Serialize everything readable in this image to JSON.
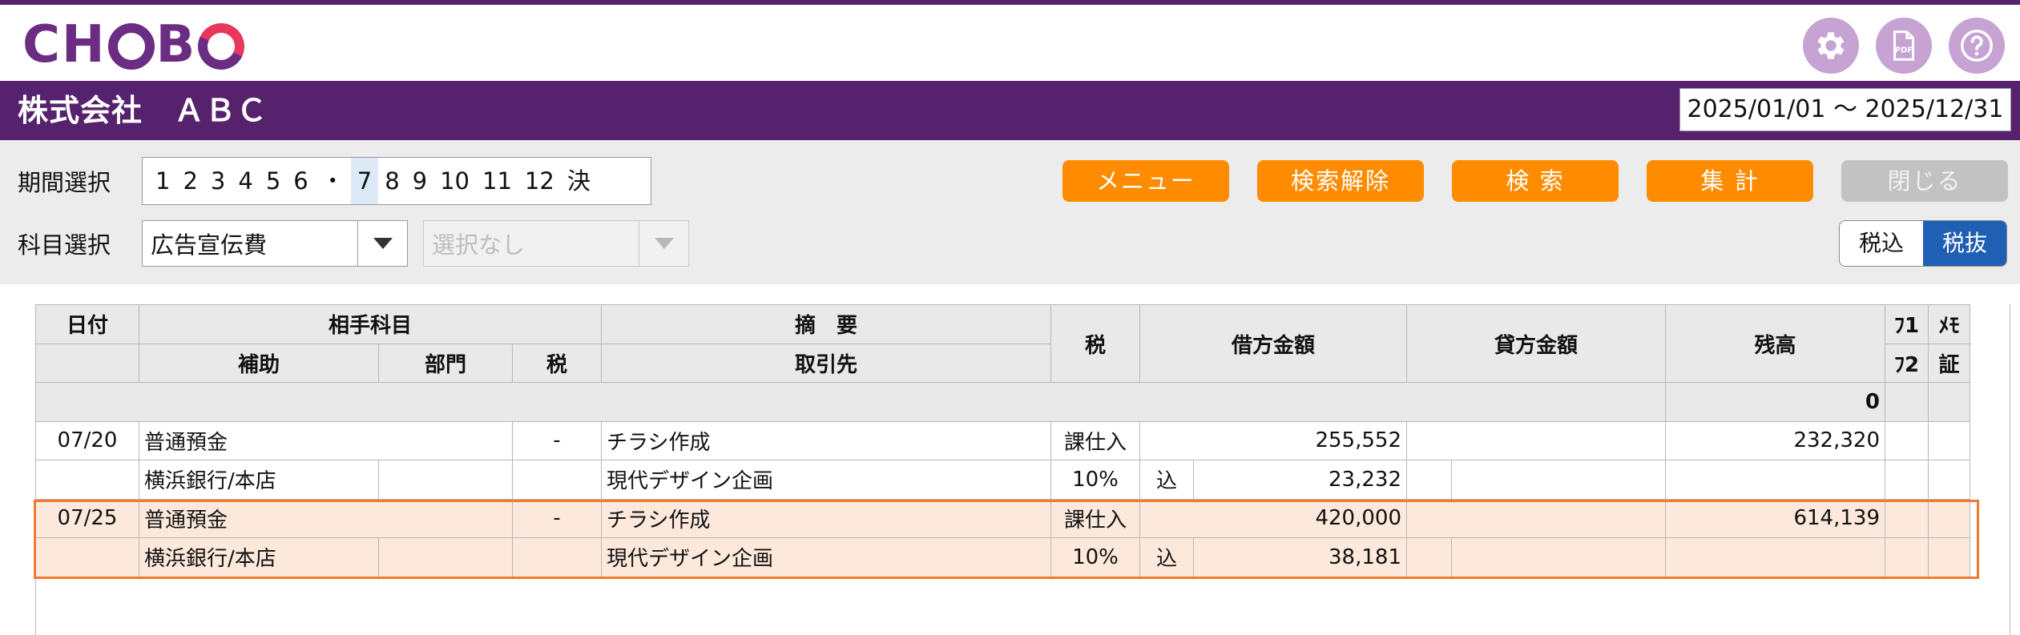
{
  "app": {
    "logo_text": "CHOBO",
    "logo_prefix": "CH",
    "logo_mid": "B",
    "brand_color": "#56226d",
    "accent_color": "#ff8c00"
  },
  "header": {
    "icons": [
      "gear-icon",
      "pdf-icon",
      "help-icon"
    ],
    "company": "株式会社　ＡＢＣ",
    "period": "2025/01/01 ～ 2025/12/31"
  },
  "toolbar": {
    "period_label": "期間選択",
    "subject_label": "科目選択",
    "months": [
      "1",
      "2",
      "3",
      "4",
      "5",
      "6",
      "・",
      "7",
      "8",
      "9",
      "10",
      "11",
      "12",
      "決"
    ],
    "selected_month": "7",
    "subject_value": "広告宣伝費",
    "sub_subject_placeholder": "選択なし",
    "menu": "メニュー",
    "clear_search": "検索解除",
    "search": "検 索",
    "summary": "集 計",
    "close": "閉じる",
    "tax_incl": "税込",
    "tax_excl": "税抜",
    "tax_mode": "税抜"
  },
  "table": {
    "headers": {
      "date": "日付",
      "counter_account": "相手科目",
      "sub_account": "補助",
      "department": "部門",
      "tax": "税",
      "summary": "摘　要",
      "partner": "取引先",
      "tax_type": "税",
      "debit": "借方金額",
      "credit": "貸方金額",
      "balance": "残高",
      "f1": "ﾌ1",
      "f2": "ﾌ2",
      "memo": "ﾒﾓ",
      "proof": "証"
    },
    "opening_balance": "0",
    "entries": [
      {
        "date": "07/20",
        "account": "普通預金",
        "tax_flag": "-",
        "summary": "チラシ作成",
        "tax_type": "課仕入",
        "debit": "255,552",
        "balance": "232,320",
        "sub_account": "横浜銀行/本店",
        "partner": "現代デザイン企画",
        "tax_rate": "10%",
        "incl_mark": "込",
        "tax_amount": "23,232"
      },
      {
        "date": "07/25",
        "account": "普通預金",
        "tax_flag": "-",
        "summary": "チラシ作成",
        "tax_type": "課仕入",
        "debit": "420,000",
        "balance": "614,139",
        "sub_account": "横浜銀行/本店",
        "partner": "現代デザイン企画",
        "tax_rate": "10%",
        "incl_mark": "込",
        "tax_amount": "38,181"
      }
    ]
  }
}
